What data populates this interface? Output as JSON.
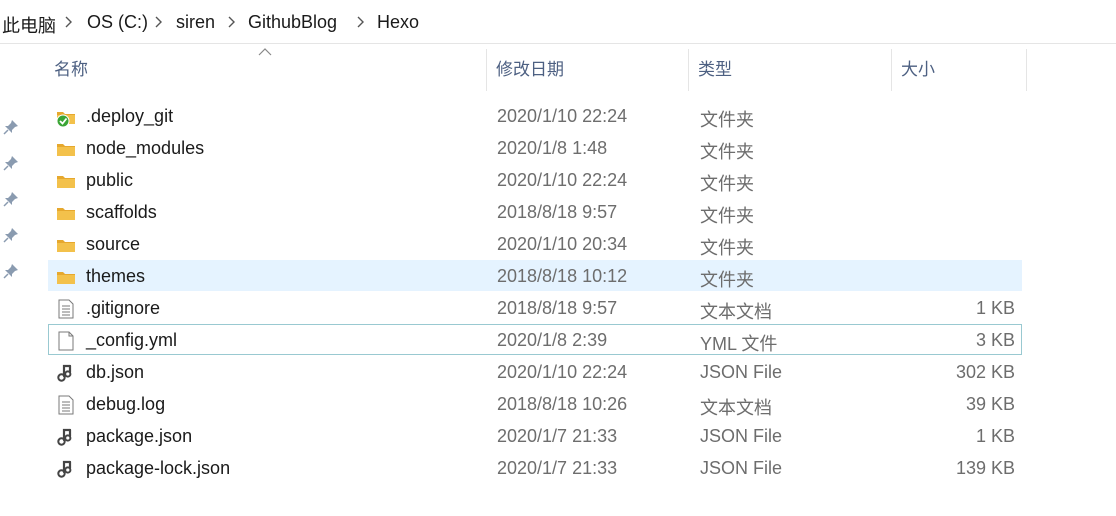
{
  "breadcrumb": {
    "items": [
      "此电脑",
      "OS (C:)",
      "siren",
      "GithubBlog",
      "Hexo"
    ]
  },
  "columns": {
    "name": "名称",
    "date": "修改日期",
    "type": "类型",
    "size": "大小"
  },
  "sort": {
    "column": "name",
    "direction": "ascending"
  },
  "colors": {
    "folder": "#f3c14b",
    "sync_check": "#3aa535",
    "selected_row": "#e5f3ff",
    "focus_border": "#99c9d1",
    "header_text": "#4d6082"
  },
  "files": [
    {
      "name": ".deploy_git",
      "date": "2020/1/10 22:24",
      "type": "文件夹",
      "size": "",
      "icon": "folder-synced-icon"
    },
    {
      "name": "node_modules",
      "date": "2020/1/8 1:48",
      "type": "文件夹",
      "size": "",
      "icon": "folder-icon"
    },
    {
      "name": "public",
      "date": "2020/1/10 22:24",
      "type": "文件夹",
      "size": "",
      "icon": "folder-icon"
    },
    {
      "name": "scaffolds",
      "date": "2018/8/18 9:57",
      "type": "文件夹",
      "size": "",
      "icon": "folder-icon"
    },
    {
      "name": "source",
      "date": "2020/1/10 20:34",
      "type": "文件夹",
      "size": "",
      "icon": "folder-icon"
    },
    {
      "name": "themes",
      "date": "2018/8/18 10:12",
      "type": "文件夹",
      "size": "",
      "icon": "folder-icon",
      "selected": true
    },
    {
      "name": ".gitignore",
      "date": "2018/8/18 9:57",
      "type": "文本文档",
      "size": "1 KB",
      "icon": "text-document-icon"
    },
    {
      "name": "_config.yml",
      "date": "2020/1/8 2:39",
      "type": "YML 文件",
      "size": "3 KB",
      "icon": "blank-file-icon",
      "focused": true
    },
    {
      "name": "db.json",
      "date": "2020/1/10 22:24",
      "type": "JSON File",
      "size": "302 KB",
      "icon": "json-file-icon"
    },
    {
      "name": "debug.log",
      "date": "2018/8/18 10:26",
      "type": "文本文档",
      "size": "39 KB",
      "icon": "text-document-icon"
    },
    {
      "name": "package.json",
      "date": "2020/1/7 21:33",
      "type": "JSON File",
      "size": "1 KB",
      "icon": "json-file-icon"
    },
    {
      "name": "package-lock.json",
      "date": "2020/1/7 21:33",
      "type": "JSON File",
      "size": "139 KB",
      "icon": "json-file-icon"
    }
  ],
  "quick_access_pins": [
    "pin-icon",
    "pin-icon",
    "pin-icon",
    "pin-icon",
    "pin-icon"
  ]
}
